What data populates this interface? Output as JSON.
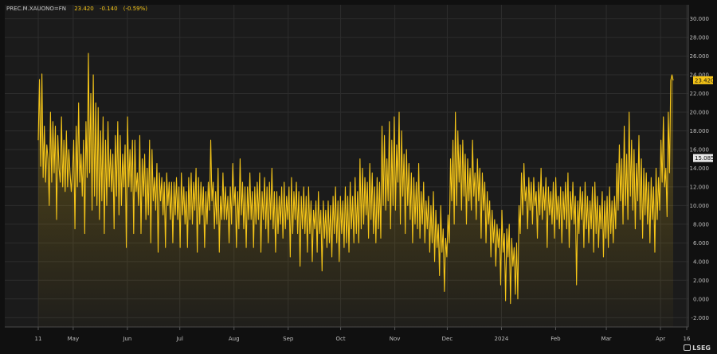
{
  "header": {
    "ric": "PREC.M.XAUONO=FN",
    "last": "23.420",
    "change": "-0.140",
    "change_pct": "(-0.59%)"
  },
  "logo": {
    "text": "LSEG"
  },
  "colors": {
    "background": "#101010",
    "plot_background": "#1b1b1b",
    "line": "#f5c518",
    "grid": "#2d2d2d",
    "axis_text": "#bdbdbd"
  },
  "chart_data": {
    "type": "area",
    "title": "",
    "xlabel": "",
    "ylabel": "",
    "ylim": [
      -3.0,
      31.5
    ],
    "y_ticks": [
      "-2.000",
      "0.000",
      "2.000",
      "4.000",
      "6.000",
      "8.000",
      "10.000",
      "12.000",
      "14.000",
      "16.000",
      "18.000",
      "20.000",
      "22.000",
      "24.000",
      "26.000",
      "28.000",
      "30.000"
    ],
    "x_tick_labels": [
      "11",
      "May",
      "Jun",
      "Jul",
      "Aug",
      "Sep",
      "Oct",
      "Nov",
      "Dec",
      "2024",
      "Feb",
      "Mar",
      "Apr",
      "16"
    ],
    "x_range": [
      "2023-04-11",
      "2024-04-16"
    ],
    "last_value_label": "23.420",
    "reference_value_label": "15.085",
    "grid": true,
    "series": [
      {
        "values": [
          17.0,
          23.5,
          14.2,
          24.1,
          13.0,
          18.5,
          12.5,
          16.5,
          15.0,
          10.0,
          20.0,
          12.5,
          19.0,
          13.5,
          18.5,
          8.5,
          17.5,
          14.0,
          12.5,
          19.5,
          12.0,
          17.0,
          11.5,
          18.0,
          12.0,
          16.0,
          13.5,
          11.5,
          13.5,
          17.0,
          7.5,
          18.5,
          12.0,
          21.0,
          12.5,
          15.5,
          11.0,
          17.0,
          7.0,
          19.0,
          13.0,
          26.3,
          13.5,
          22.0,
          9.5,
          24.0,
          11.0,
          21.0,
          10.0,
          20.5,
          8.5,
          18.0,
          10.5,
          19.5,
          7.0,
          17.0,
          10.0,
          19.0,
          12.0,
          16.0,
          11.5,
          15.5,
          7.5,
          17.5,
          11.0,
          19.0,
          9.0,
          17.5,
          10.0,
          15.5,
          12.0,
          16.5,
          5.5,
          19.5,
          12.0,
          16.0,
          11.5,
          17.0,
          7.0,
          17.0,
          11.5,
          13.5,
          10.0,
          17.5,
          7.0,
          15.0,
          11.0,
          15.5,
          8.5,
          14.0,
          9.0,
          17.0,
          6.0,
          16.0,
          10.5,
          13.0,
          9.5,
          14.5,
          5.0,
          13.5,
          10.5,
          13.0,
          9.0,
          12.5,
          5.5,
          13.5,
          10.0,
          12.5,
          8.5,
          12.5,
          6.0,
          12.5,
          9.0,
          13.0,
          8.5,
          12.0,
          5.5,
          13.5,
          9.0,
          12.0,
          8.0,
          11.5,
          5.5,
          13.0,
          8.5,
          13.5,
          8.0,
          12.5,
          9.5,
          14.0,
          5.0,
          13.0,
          8.0,
          12.5,
          9.0,
          12.0,
          5.5,
          11.5,
          8.0,
          12.5,
          9.5,
          17.0,
          10.5,
          12.5,
          7.5,
          11.5,
          8.0,
          14.0,
          5.0,
          11.0,
          8.5,
          13.5,
          8.5,
          12.0,
          8.5,
          11.0,
          6.0,
          12.0,
          8.0,
          14.5,
          10.0,
          12.0,
          5.5,
          11.5,
          7.5,
          15.0,
          9.0,
          12.5,
          7.5,
          12.0,
          5.5,
          12.0,
          8.5,
          13.5,
          8.5,
          11.5,
          5.5,
          12.0,
          8.0,
          12.5,
          8.5,
          13.5,
          5.0,
          11.5,
          8.5,
          13.0,
          7.5,
          12.0,
          6.0,
          12.5,
          8.5,
          14.0,
          7.5,
          11.5,
          5.0,
          11.5,
          7.0,
          11.0,
          8.0,
          12.0,
          6.5,
          12.5,
          7.5,
          11.0,
          8.5,
          12.0,
          4.5,
          13.0,
          7.0,
          11.5,
          8.5,
          12.5,
          7.0,
          11.5,
          3.5,
          11.0,
          7.5,
          12.0,
          7.0,
          11.0,
          5.0,
          12.0,
          7.0,
          10.5,
          4.0,
          9.5,
          7.5,
          10.5,
          5.0,
          11.5,
          7.0,
          9.5,
          3.0,
          10.5,
          6.5,
          9.5,
          5.5,
          10.5,
          6.0,
          10.0,
          4.5,
          11.0,
          7.0,
          12.0,
          6.0,
          10.5,
          4.0,
          11.0,
          7.0,
          10.5,
          5.5,
          12.0,
          6.0,
          11.0,
          5.0,
          12.5,
          7.5,
          11.0,
          6.0,
          13.0,
          7.0,
          11.5,
          6.0,
          15.0,
          7.5,
          14.0,
          8.0,
          13.0,
          9.0,
          12.5,
          6.5,
          14.5,
          8.5,
          13.5,
          7.0,
          12.0,
          6.0,
          13.0,
          7.5,
          12.5,
          6.5,
          18.5,
          10.0,
          17.5,
          9.5,
          15.0,
          10.5,
          19.0,
          7.5,
          17.0,
          10.0,
          19.5,
          9.5,
          16.5,
          12.5,
          20.0,
          8.0,
          18.0,
          11.0,
          15.5,
          7.0,
          16.0,
          10.0,
          14.5,
          8.5,
          13.5,
          6.0,
          13.0,
          8.0,
          12.5,
          7.5,
          14.5,
          6.5,
          11.5,
          8.0,
          12.5,
          6.0,
          10.5,
          7.5,
          11.0,
          5.0,
          10.0,
          6.0,
          11.5,
          4.0,
          9.5,
          5.5,
          8.0,
          2.5,
          10.0,
          5.0,
          7.5,
          0.8,
          6.5,
          4.5,
          9.0,
          6.0,
          15.0,
          10.5,
          17.0,
          8.0,
          20.0,
          10.0,
          18.0,
          12.5,
          16.5,
          9.5,
          17.0,
          11.0,
          15.5,
          8.0,
          15.0,
          10.5,
          14.0,
          9.5,
          17.0,
          11.0,
          13.5,
          8.5,
          15.0,
          10.5,
          14.0,
          6.5,
          13.5,
          9.5,
          12.5,
          6.0,
          11.5,
          8.0,
          10.5,
          4.5,
          9.5,
          6.0,
          8.5,
          3.5,
          8.0,
          5.5,
          7.5,
          1.5,
          9.5,
          5.0,
          7.0,
          -0.2,
          7.5,
          4.5,
          8.0,
          -0.5,
          6.5,
          3.5,
          5.5,
          0.5,
          6.0,
          0.0,
          10.0,
          7.0,
          13.5,
          9.0,
          14.5,
          10.5,
          12.0,
          7.5,
          13.0,
          9.5,
          12.5,
          8.0,
          13.0,
          10.0,
          11.5,
          6.5,
          12.5,
          9.0,
          14.0,
          8.5,
          12.0,
          9.5,
          13.0,
          5.5,
          12.0,
          9.0,
          11.5,
          8.0,
          12.5,
          6.5,
          13.0,
          8.5,
          11.0,
          7.5,
          12.0,
          6.0,
          11.5,
          8.5,
          12.5,
          7.5,
          13.5,
          5.5,
          11.5,
          8.5,
          12.5,
          8.0,
          11.0,
          1.5,
          10.5,
          7.0,
          12.0,
          8.5,
          11.5,
          5.5,
          12.5,
          7.5,
          11.0,
          6.0,
          10.5,
          7.5,
          12.0,
          5.0,
          12.5,
          7.0,
          11.0,
          5.5,
          10.0,
          7.5,
          11.5,
          4.5,
          10.5,
          6.5,
          11.0,
          5.5,
          12.0,
          7.0,
          10.5,
          6.0,
          11.0,
          7.5,
          14.5,
          9.5,
          16.5,
          10.5,
          15.0,
          8.0,
          18.5,
          10.0,
          15.5,
          8.5,
          20.0,
          11.0,
          17.0,
          9.5,
          16.0,
          7.5,
          14.5,
          10.5,
          17.5,
          8.5,
          15.0,
          6.5,
          14.0,
          9.0,
          13.5,
          8.0,
          12.5,
          6.0,
          13.0,
          8.5,
          12.0,
          5.0,
          14.0,
          8.5,
          13.0,
          9.5,
          17.0,
          12.5,
          19.5,
          12.0,
          14.0,
          8.8,
          20.0,
          13.5,
          23.4,
          24.0,
          23.4
        ]
      }
    ]
  }
}
